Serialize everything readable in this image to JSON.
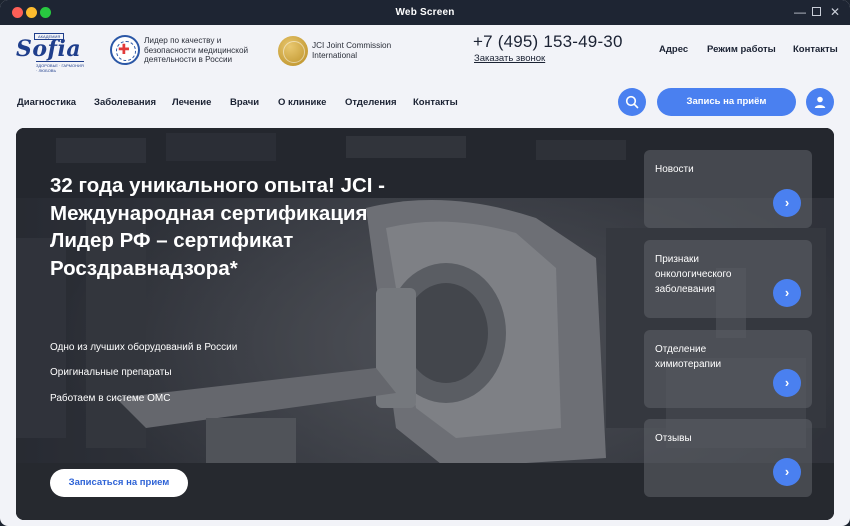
{
  "window": {
    "title": "Web Screen"
  },
  "header": {
    "logo": {
      "top": "АКАДЕМИЯ",
      "name": "Sofia",
      "bottom": "ЗДОРОВЬЕ · ГАРМОНИЯ · ЛЮБОВЬ"
    },
    "badges": [
      {
        "text": "Лидер по качеству и безопасности медицинской деятельности в России",
        "icon": "quality-emblem-icon"
      },
      {
        "text": "JCI Joint Commission International",
        "icon": "jci-seal-icon"
      }
    ],
    "phone": "+7 (495) 153-49-30",
    "callback": "Заказать звонок",
    "links": [
      "Адрес",
      "Режим работы",
      "Контакты"
    ]
  },
  "nav": {
    "items": [
      "Диагностика",
      "Заболевания",
      "Лечение",
      "Врачи",
      "О клинике",
      "Отделения",
      "Контакты"
    ],
    "appointment_button": "Запись на приём"
  },
  "hero": {
    "title": "32 года уникального опыта! JCI - Международная сертификация Лидер РФ – сертификат Росздравнадзора*",
    "lines": [
      "Одно из лучших оборудований в России",
      "Оригинальные препараты",
      "Работаем в системе ОМС"
    ],
    "cta": "Записаться на прием",
    "cards": [
      "Новости",
      "Признаки онкологического заболевания",
      "Отделение химиотерапии",
      "Отзывы"
    ]
  },
  "colors": {
    "accent": "#4a80f0",
    "title_bar": "#1e2533",
    "page_bg": "#f2f3f8",
    "brand": "#1f3e8c"
  }
}
